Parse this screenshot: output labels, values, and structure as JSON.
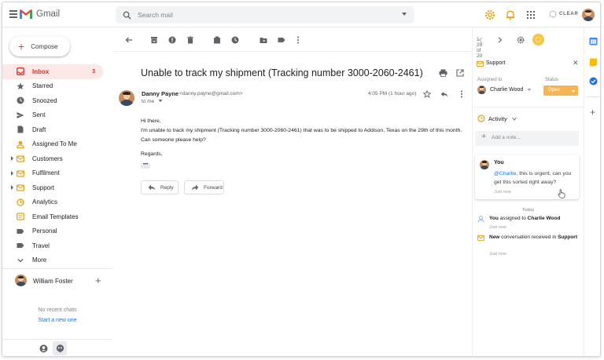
{
  "header": {
    "app_name": "Gmail",
    "search_placeholder": "Search mail",
    "clear_label": "CLEAR"
  },
  "sidebar": {
    "compose_label": "Compose",
    "items": [
      {
        "label": "Inbox",
        "count": "3",
        "icon": "inbox-icon",
        "active": true,
        "expandable": false
      },
      {
        "label": "Starred",
        "count": "",
        "icon": "star-icon",
        "active": false,
        "expandable": false
      },
      {
        "label": "Snoozed",
        "count": "",
        "icon": "clock-icon",
        "active": false,
        "expandable": false
      },
      {
        "label": "Sent",
        "count": "",
        "icon": "send-icon",
        "active": false,
        "expandable": false
      },
      {
        "label": "Draft",
        "count": "",
        "icon": "draft-icon",
        "active": false,
        "expandable": false
      },
      {
        "label": "Assigned To Me",
        "count": "",
        "icon": "person-icon",
        "active": false,
        "expandable": false
      },
      {
        "label": "Customers",
        "count": "",
        "icon": "mailbox-icon",
        "active": false,
        "expandable": true
      },
      {
        "label": "Fulfilment",
        "count": "",
        "icon": "mailbox-icon",
        "active": false,
        "expandable": true
      },
      {
        "label": "Support",
        "count": "",
        "icon": "mailbox-icon",
        "active": false,
        "expandable": true
      },
      {
        "label": "Analytics",
        "count": "",
        "icon": "analytics-icon",
        "active": false,
        "expandable": false
      },
      {
        "label": "Email Templates",
        "count": "",
        "icon": "template-icon",
        "active": false,
        "expandable": false
      },
      {
        "label": "Personal",
        "count": "",
        "icon": "label-icon",
        "active": false,
        "expandable": false
      },
      {
        "label": "Travel",
        "count": "",
        "icon": "label-icon",
        "active": false,
        "expandable": false
      },
      {
        "label": "More",
        "count": "",
        "icon": "chevron-down-icon",
        "active": false,
        "expandable": false
      }
    ],
    "chat_user": "William Foster",
    "no_chats": "No recent chats",
    "start_new": "Start a new one"
  },
  "toolbar": {
    "pagination": "1-29 of 20"
  },
  "email": {
    "subject": "Unable to track my shipment (Tracking number 3000-2060-2461)",
    "sender_name": "Danny Payne",
    "sender_email": "<danny.payne@gmail.com>",
    "to": "to me",
    "time": "4:05 PM (1 hour ago)",
    "body": [
      "Hi there,",
      "I'm unable to track my shipment (Tracking number 3000-2060-2461) that was to be shipped to Addison, Texas on the 29th of this month.",
      "Can someone please help?",
      "Regards,"
    ],
    "ellipsis": "•••",
    "reply_label": "Reply",
    "forward_label": "Forward"
  },
  "panel": {
    "title": "Support",
    "assigned_to_label": "Assigned to",
    "status_label": "Status",
    "assignee": "Charlie Wood",
    "status": "Open",
    "activity_label": "Activity",
    "note_placeholder": "Add a note...",
    "comment": {
      "author": "You",
      "mention": "@Charlie",
      "text": ", this is urgent, can you get this sorted right away?",
      "time": "Just now"
    },
    "today_label": "Today",
    "events": [
      {
        "prefix": "You",
        "middle": " assigned to ",
        "suffix": "Charlie Wood",
        "time": "Just now"
      },
      {
        "prefix": "New",
        "middle": " conversation received in ",
        "suffix": "Support",
        "time": "Just now"
      }
    ]
  },
  "colors": {
    "accent_red": "#d93025",
    "status_orange": "#f6b552",
    "link_blue": "#1a73e8"
  }
}
